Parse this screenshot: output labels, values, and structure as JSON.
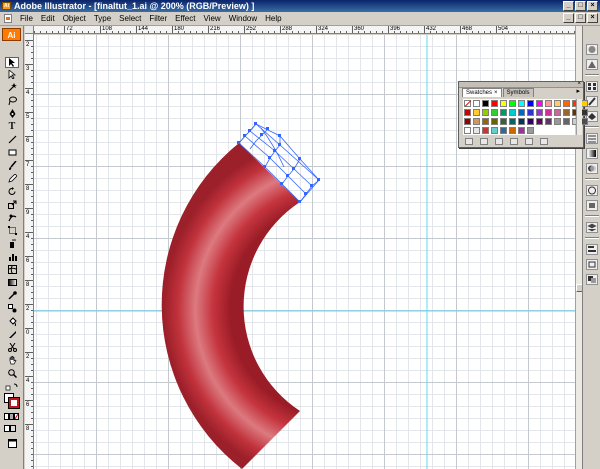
{
  "window": {
    "title": "Adobe Illustrator - [finaltut_1.ai @ 200% (RGB/Preview) ]",
    "app_icon_text": "Ai",
    "minimize_label": "_",
    "maximize_label": "□",
    "close_label": "×"
  },
  "menus": [
    "File",
    "Edit",
    "Object",
    "Type",
    "Select",
    "Filter",
    "Effect",
    "View",
    "Window",
    "Help"
  ],
  "toolbox": {
    "logo": "Ai"
  },
  "ruler_top": [
    "72",
    "108",
    "144",
    "180",
    "216",
    "252",
    "288",
    "324",
    "360",
    "396",
    "432",
    "468",
    "504"
  ],
  "ruler_left": [
    "2",
    "3",
    "4",
    "5",
    "6",
    "7",
    "8",
    "9",
    "4",
    "6",
    "8",
    "2",
    "0",
    "2",
    "4",
    "6",
    "8"
  ],
  "swatches_panel": {
    "tabs": [
      "Swatches",
      "Symbols"
    ],
    "tab_close": "×",
    "menu": "▸",
    "colors_row1": [
      "none",
      "#ffffff",
      "#000000",
      "#ff0000",
      "#ffff00",
      "#00ff00",
      "#00ffff",
      "#0000ff",
      "#ff00ff",
      "#ff9999",
      "#ffcc66",
      "#ff6600",
      "#ff3300",
      "#ffcc00"
    ],
    "colors_row2": [
      "#cc0000",
      "#ffcc33",
      "#99cc00",
      "#33cc33",
      "#009966",
      "#00cccc",
      "#0066cc",
      "#3333cc",
      "#9933cc",
      "#cc3399",
      "#cc6699",
      "#996633",
      "#663300",
      "#333333"
    ],
    "colors_row3": [
      "#990000",
      "#cc9966",
      "#996600",
      "#666600",
      "#336633",
      "#006666",
      "#003366",
      "#330066",
      "#660066",
      "#663366",
      "#999999",
      "#666666",
      "#cccccc",
      "#4d4d4d"
    ],
    "colors_row4": [
      "#ffffff",
      "#e6e6e6",
      "#cc3333",
      "#66cccc",
      "#336699",
      "#cc6600",
      "#993399",
      "#999999"
    ]
  },
  "colors": {
    "arc_dark": "#a8242e",
    "arc_mid": "#c23640",
    "arc_light": "#e07a80",
    "mesh": "#3366ff",
    "guide": "#5fdcf0"
  }
}
